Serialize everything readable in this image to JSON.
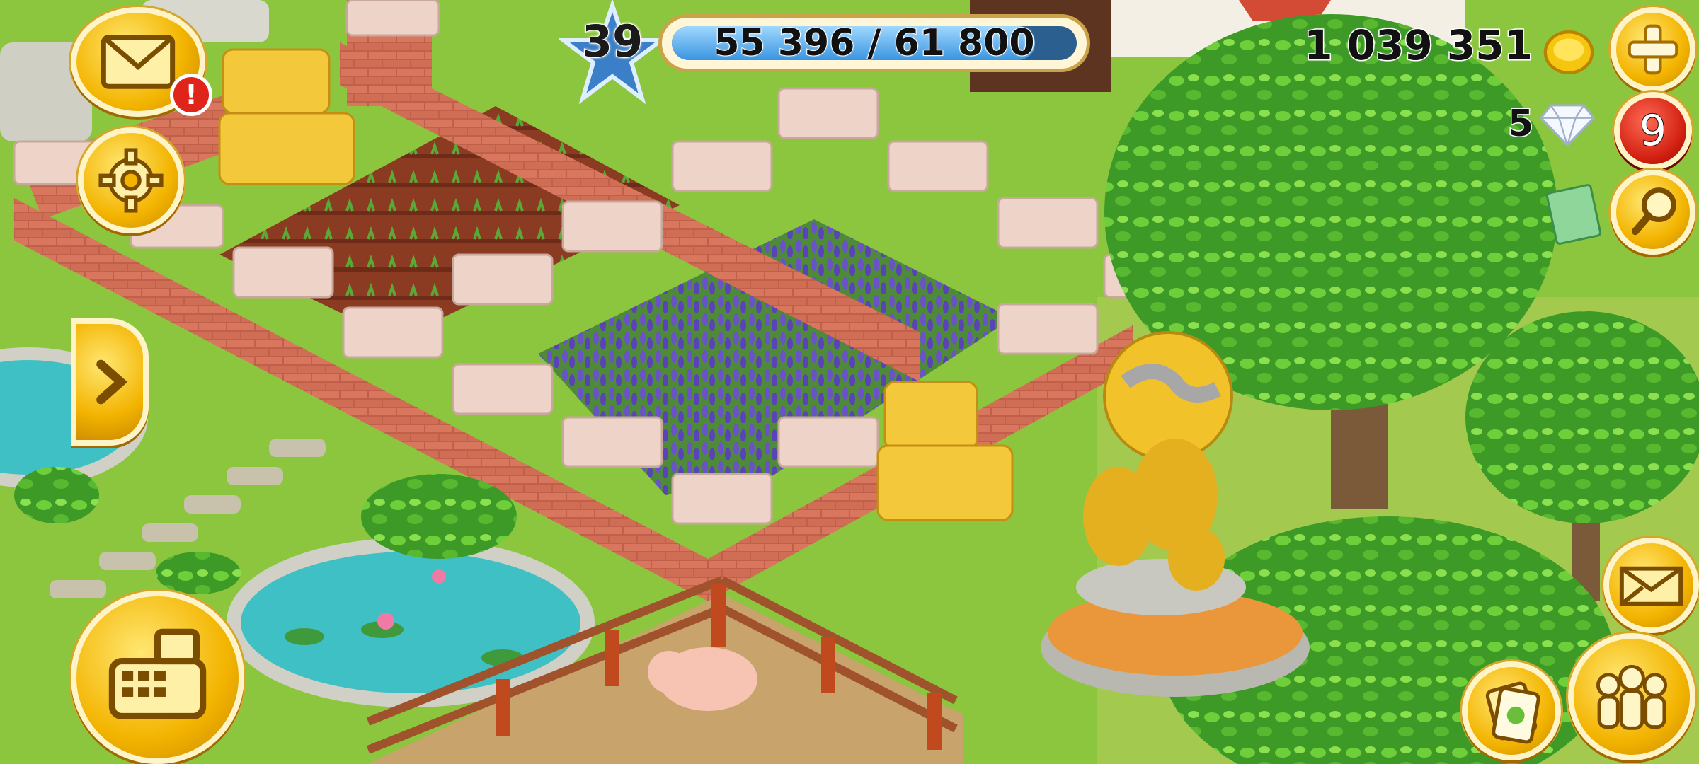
{
  "hud": {
    "level": "39",
    "xp_text": "55 396 / 61 800",
    "xp_fraction": 0.896,
    "coins": "1 039 351",
    "diamonds": "5",
    "notification_count": "9",
    "mail_alert": "!"
  },
  "icons": {
    "mail": "envelope-icon",
    "settings": "gear-icon",
    "expand": "chevron-right-icon",
    "shop": "cash-register-icon",
    "add": "plus-icon",
    "search": "magnifier-icon",
    "map": "map-icon",
    "friends": "friends-icon",
    "cards": "cards-icon",
    "coin": "coin-icon",
    "diamond": "diamond-icon"
  },
  "colors": {
    "grass": "#8cc63f",
    "xp_fill": "#3a95e0",
    "button_yellow": "#f3b400",
    "badge_red": "#d11f10"
  }
}
